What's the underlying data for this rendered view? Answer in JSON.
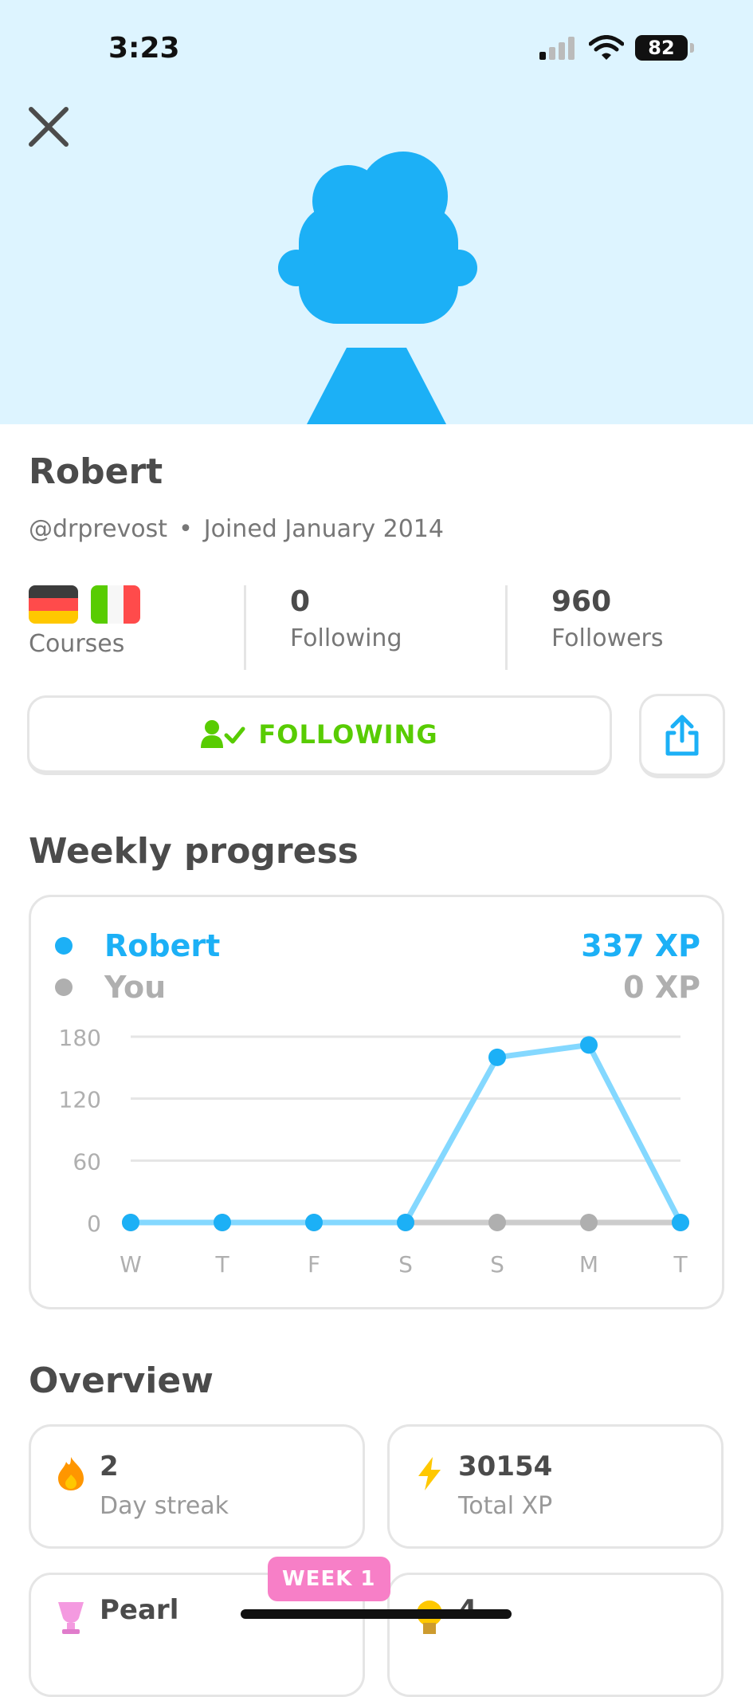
{
  "status_bar": {
    "time": "3:23",
    "battery": "82"
  },
  "profile": {
    "name": "Robert",
    "username": "@drprevost",
    "joined": "Joined January 2014"
  },
  "stats": {
    "courses_label": "Courses",
    "following_count": "0",
    "following_label": "Following",
    "followers_count": "960",
    "followers_label": "Followers"
  },
  "actions": {
    "following_label": "FOLLOWING"
  },
  "weekly_progress": {
    "title": "Weekly progress",
    "legend": [
      {
        "name": "Robert",
        "xp": "337 XP",
        "color": "#1cb0f6"
      },
      {
        "name": "You",
        "xp": "0 XP",
        "color": "#afafaf"
      }
    ]
  },
  "chart_data": {
    "type": "line",
    "categories": [
      "W",
      "T",
      "F",
      "S",
      "S",
      "M",
      "T"
    ],
    "series": [
      {
        "name": "Robert",
        "values": [
          0,
          0,
          0,
          0,
          160,
          172,
          0
        ],
        "color": "#1cb0f6"
      },
      {
        "name": "You",
        "values": [
          0,
          0,
          0,
          0,
          0,
          0,
          0
        ],
        "color": "#afafaf"
      }
    ],
    "yticks": [
      0,
      60,
      120,
      180
    ],
    "ylim": [
      0,
      180
    ],
    "grid": true
  },
  "overview": {
    "title": "Overview",
    "cards": [
      {
        "value": "2",
        "label": "Day streak",
        "icon": "fire-icon"
      },
      {
        "value": "30154",
        "label": "Total XP",
        "icon": "lightning-icon"
      },
      {
        "value": "Pearl",
        "label": "",
        "icon": "pearl-trophy-icon"
      },
      {
        "value": "4",
        "label": "",
        "icon": "medal-icon"
      }
    ],
    "badge": "WEEK 1"
  }
}
